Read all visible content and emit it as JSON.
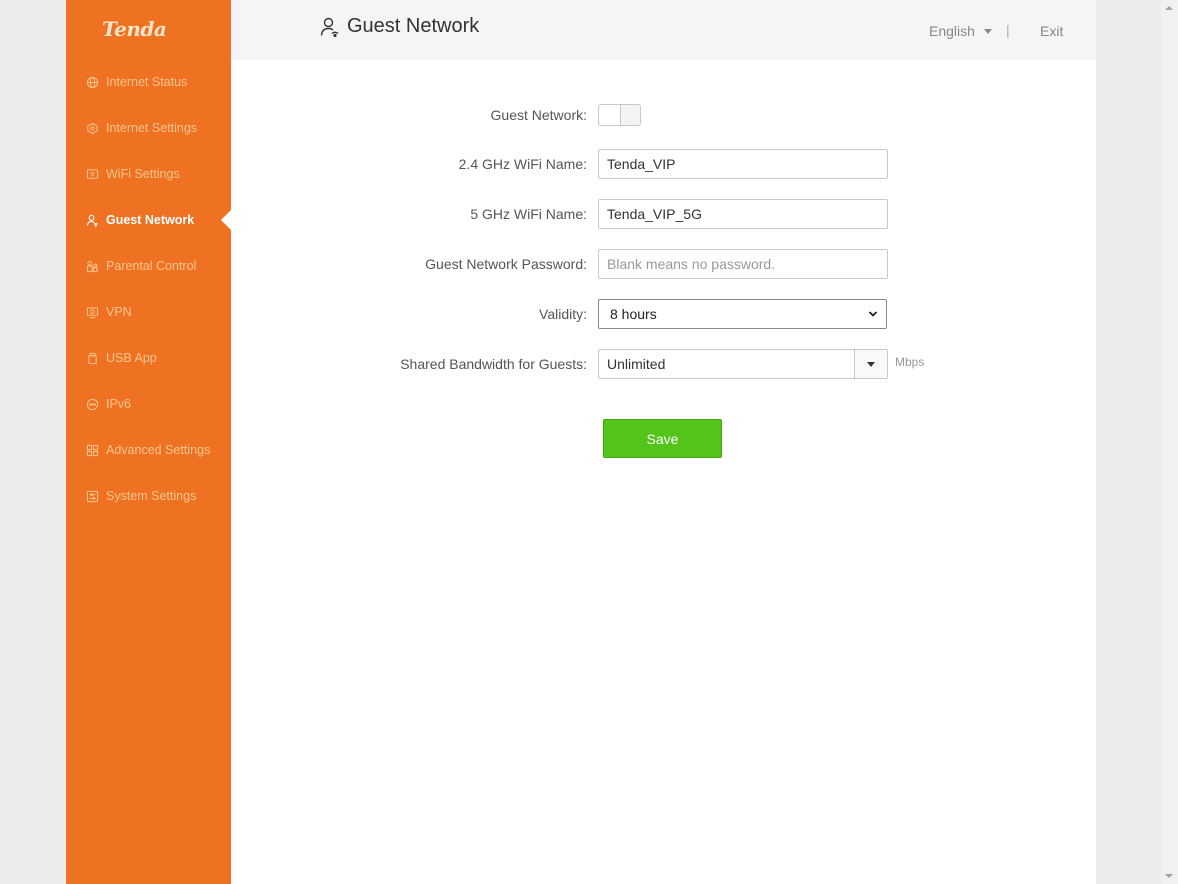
{
  "brand": {
    "logo": "Tenda",
    "accent": "#ef7122",
    "save_color": "#52c41a"
  },
  "sidebar": {
    "items": [
      {
        "label": "Internet Status",
        "icon": "globe-icon"
      },
      {
        "label": "Internet Settings",
        "icon": "settings-icon"
      },
      {
        "label": "WiFi Settings",
        "icon": "wifi-icon"
      },
      {
        "label": "Guest Network",
        "icon": "guest-user-icon",
        "active": true
      },
      {
        "label": "Parental Control",
        "icon": "parental-icon"
      },
      {
        "label": "VPN",
        "icon": "vpn-icon"
      },
      {
        "label": "USB App",
        "icon": "usb-icon"
      },
      {
        "label": "IPv6",
        "icon": "ipv6-icon"
      },
      {
        "label": "Advanced Settings",
        "icon": "grid-icon"
      },
      {
        "label": "System Settings",
        "icon": "system-icon"
      }
    ]
  },
  "header": {
    "title": "Guest Network",
    "language": "English",
    "separator": "|",
    "exit": "Exit"
  },
  "form": {
    "guest_network": {
      "label": "Guest Network:",
      "enabled": false
    },
    "wifi_24": {
      "label": "2.4 GHz WiFi Name:",
      "value": "Tenda_VIP"
    },
    "wifi_5": {
      "label": "5 GHz WiFi Name:",
      "value": "Tenda_VIP_5G"
    },
    "password": {
      "label": "Guest Network Password:",
      "value": "",
      "placeholder": "Blank means no password."
    },
    "validity": {
      "label": "Validity:",
      "value": "8 hours"
    },
    "bandwidth": {
      "label": "Shared Bandwidth for Guests:",
      "value": "Unlimited",
      "unit": "Mbps"
    },
    "save_label": "Save"
  }
}
